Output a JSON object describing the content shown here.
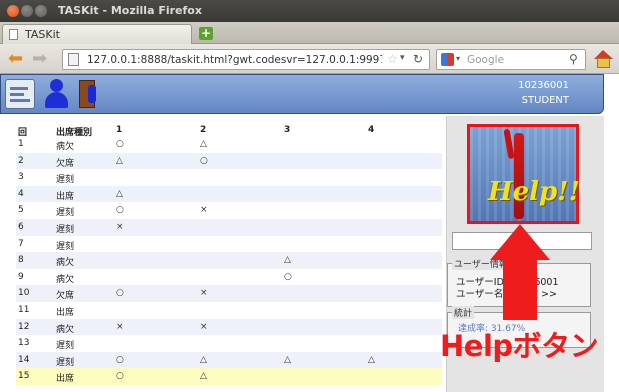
{
  "window": {
    "title": "TASKit - Mozilla Firefox"
  },
  "tab": {
    "label": "TASKit"
  },
  "navbar": {
    "url": "127.0.0.1:8888/taskit.html?gwt.codesvr=127.0.0.1:9997#",
    "search_placeholder": "Google"
  },
  "app": {
    "user_id": "10236001",
    "user_role": "STUDENT",
    "icons": [
      "student-card-icon",
      "user-icon",
      "exit-door-icon"
    ]
  },
  "table": {
    "headers": [
      "回",
      "出席種別",
      "1",
      "2",
      "3",
      "4"
    ],
    "rows": [
      [
        "1",
        "病欠",
        "○",
        "△",
        "",
        ""
      ],
      [
        "2",
        "欠席",
        "△",
        "○",
        "",
        ""
      ],
      [
        "3",
        "遅刻",
        "",
        "",
        "",
        ""
      ],
      [
        "4",
        "出席",
        "△",
        "",
        "",
        ""
      ],
      [
        "5",
        "遅刻",
        "○",
        "×",
        "",
        ""
      ],
      [
        "6",
        "遅刻",
        "×",
        "",
        "",
        ""
      ],
      [
        "7",
        "遅刻",
        "",
        "",
        "",
        ""
      ],
      [
        "8",
        "病欠",
        "",
        "",
        "△",
        ""
      ],
      [
        "9",
        "病欠",
        "",
        "",
        "○",
        ""
      ],
      [
        "10",
        "欠席",
        "○",
        "×",
        "",
        ""
      ],
      [
        "11",
        "出席",
        "",
        "",
        "",
        ""
      ],
      [
        "12",
        "病欠",
        "×",
        "×",
        "",
        ""
      ],
      [
        "13",
        "遅刻",
        "",
        "",
        "",
        ""
      ],
      [
        "14",
        "遅刻",
        "○",
        "△",
        "△",
        "△"
      ],
      [
        "15",
        "出席",
        "○",
        "△",
        "",
        ""
      ]
    ]
  },
  "panel": {
    "help_button_text": "Help!!",
    "user_info_legend": "ユーザー情報",
    "user_id_line": "ユーザーID: 10236001",
    "user_name_line": "ユーザー名: 未設定 >>",
    "stats_legend": "統計",
    "stats_rate": "達成率: 31.67%"
  },
  "annotation": {
    "label": "Helpボタン",
    "color": "#ee1c1c"
  }
}
